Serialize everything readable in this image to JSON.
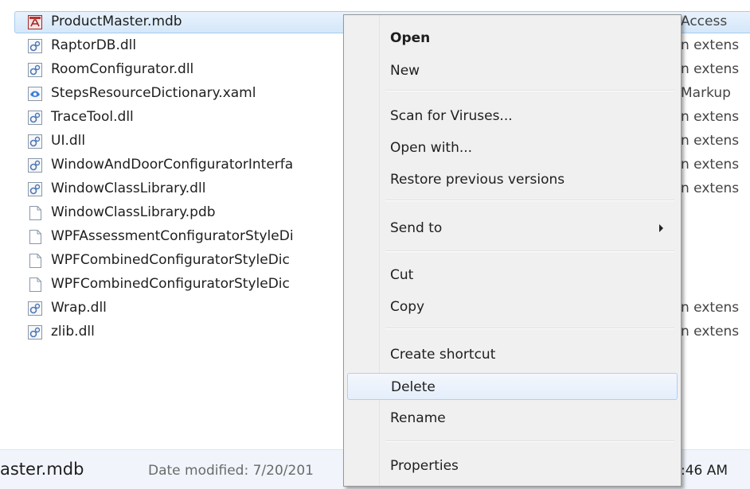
{
  "file_list": {
    "rows": [
      {
        "name": "ProductMaster.mdb",
        "type": "Access",
        "icon": "access-database-icon",
        "selected": true
      },
      {
        "name": "RaptorDB.dll",
        "type": "n extens",
        "icon": "dll-file-icon"
      },
      {
        "name": "RoomConfigurator.dll",
        "type": "n extens",
        "icon": "dll-file-icon"
      },
      {
        "name": "StepsResourceDictionary.xaml",
        "type": "Markup",
        "icon": "xaml-file-icon"
      },
      {
        "name": "TraceTool.dll",
        "type": "n extens",
        "icon": "dll-file-icon"
      },
      {
        "name": "UI.dll",
        "type": "n extens",
        "icon": "dll-file-icon"
      },
      {
        "name": "WindowAndDoorConfiguratorInterfa",
        "type": "n extens",
        "icon": "dll-file-icon"
      },
      {
        "name": "WindowClassLibrary.dll",
        "type": "n extens",
        "icon": "dll-file-icon"
      },
      {
        "name": "WindowClassLibrary.pdb",
        "type": "",
        "icon": "blank-file-icon"
      },
      {
        "name": "WPFAssessmentConfiguratorStyleDi",
        "type": "",
        "icon": "blank-file-icon"
      },
      {
        "name": "WPFCombinedConfiguratorStyleDic",
        "type": "",
        "icon": "blank-file-icon"
      },
      {
        "name": "WPFCombinedConfiguratorStyleDic",
        "type": "",
        "icon": "blank-file-icon"
      },
      {
        "name": "Wrap.dll",
        "type": "n extens",
        "icon": "dll-file-icon"
      },
      {
        "name": "zlib.dll",
        "type": "n extens",
        "icon": "dll-file-icon"
      }
    ]
  },
  "context_menu": {
    "items": [
      {
        "label": "Open",
        "bold": true
      },
      {
        "label": "New"
      },
      {
        "separator": true
      },
      {
        "label": "Scan for Viruses..."
      },
      {
        "label": "Open with..."
      },
      {
        "label": "Restore previous versions"
      },
      {
        "separator": true
      },
      {
        "label": "Send to",
        "submenu": true
      },
      {
        "separator": true
      },
      {
        "label": "Cut"
      },
      {
        "label": "Copy"
      },
      {
        "separator": true
      },
      {
        "label": "Create shortcut"
      },
      {
        "label": "Delete",
        "hover": true
      },
      {
        "label": "Rename"
      },
      {
        "separator": true
      },
      {
        "label": "Properties"
      }
    ]
  },
  "status_bar": {
    "filename": "aster.mdb",
    "date_label": "Date modified: 7/20/201",
    "time": ":46 AM"
  },
  "colors": {
    "selection_fill": "#d9e8fb",
    "selection_border": "#a7cdf0",
    "menu_background": "#f0f0f0",
    "menu_hover_border": "#aecff7"
  }
}
